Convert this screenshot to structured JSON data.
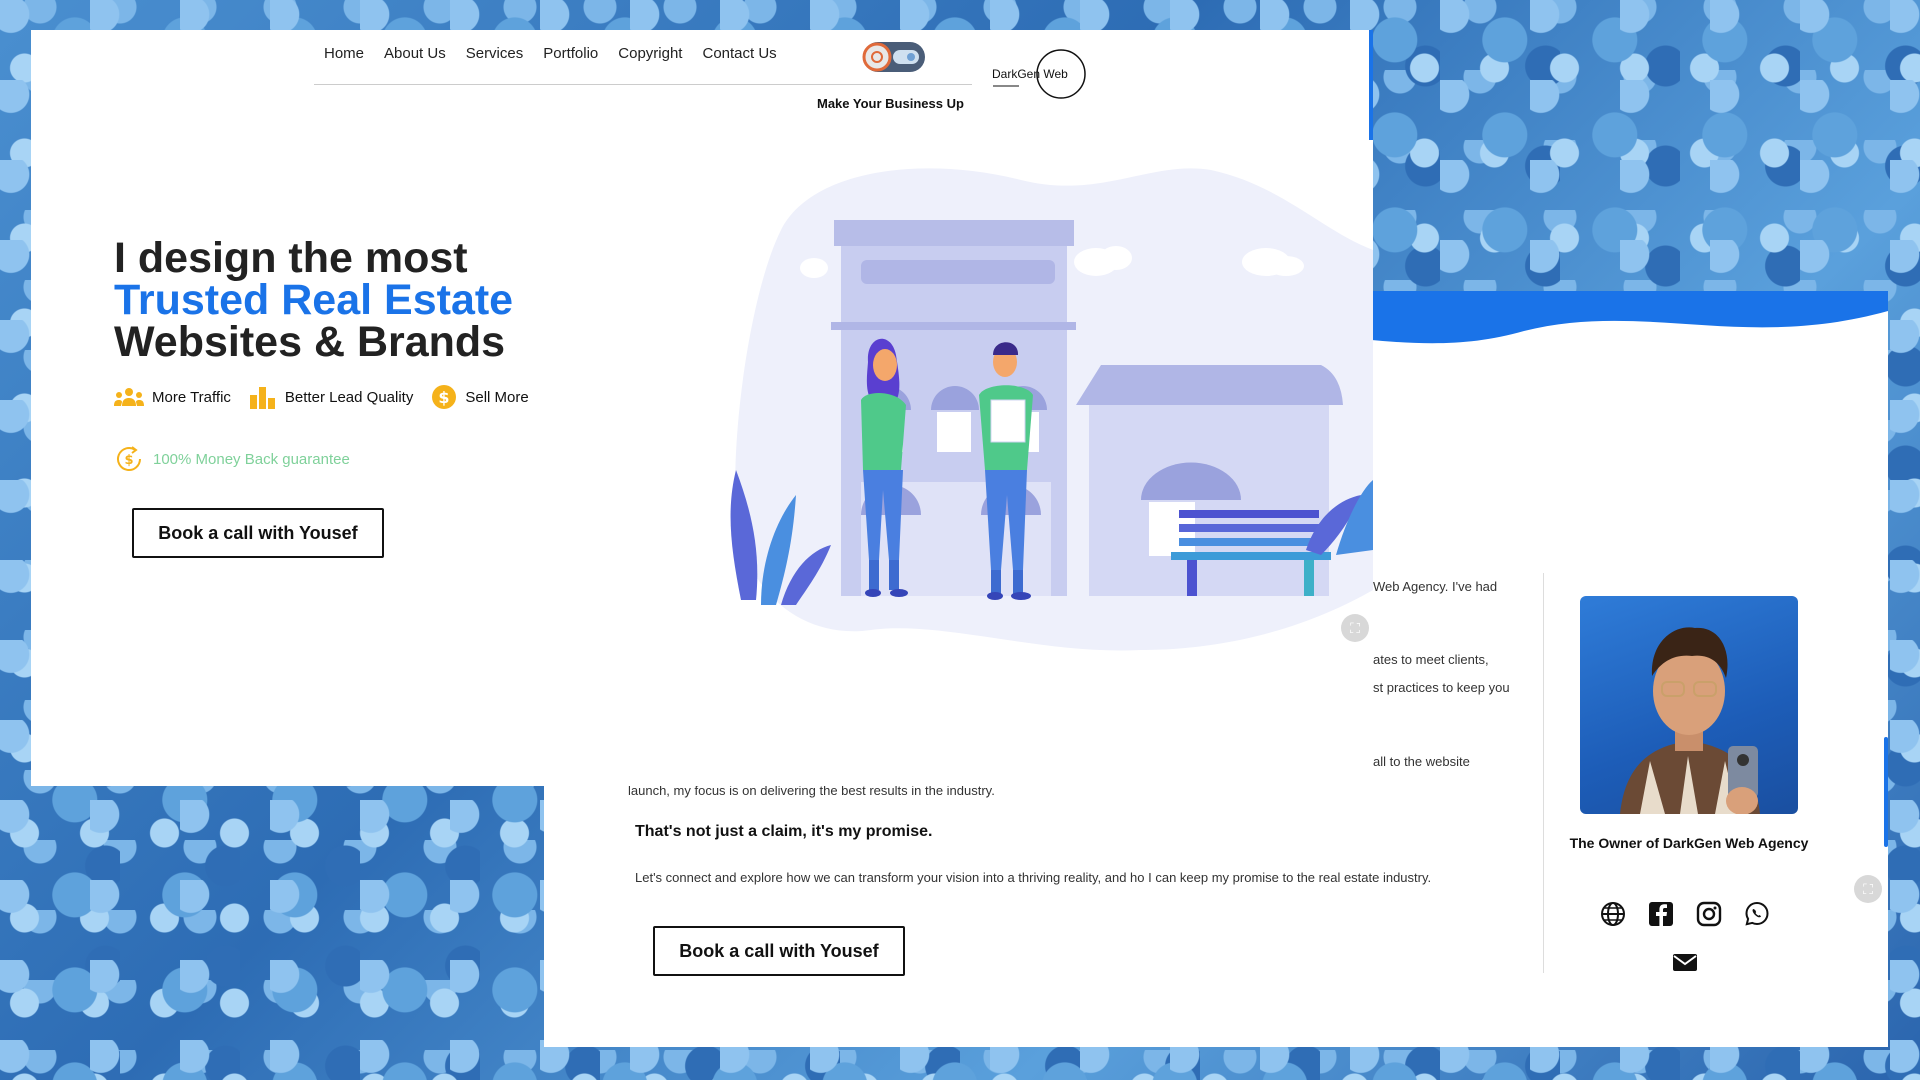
{
  "nav": {
    "items": [
      {
        "label": "Home"
      },
      {
        "label": "About Us"
      },
      {
        "label": "Services"
      },
      {
        "label": "Portfolio"
      },
      {
        "label": "Copyright"
      },
      {
        "label": "Contact Us"
      }
    ],
    "tagline": "Make Your Business Up",
    "brand_logo_text": "DarkGen Web"
  },
  "hero": {
    "title_line1": "I design the most",
    "title_line2": "Trusted Real Estate",
    "title_line3": "Websites & Brands",
    "accent_color": "#1a73e8",
    "features": [
      {
        "icon": "people-icon",
        "label": "More Traffic"
      },
      {
        "icon": "bar-chart-icon",
        "label": "Better Lead Quality"
      },
      {
        "icon": "dollar-coin-icon",
        "label": "Sell More"
      }
    ],
    "guarantee": "100% Money Back guarantee",
    "cta": "Book a call with Yousef"
  },
  "about": {
    "bio_fragments": [
      "Web Agency. I've had",
      "ates to meet clients,",
      "st practices to keep you",
      "all to the website",
      "launch, my focus is on delivering the best results in the industry."
    ],
    "promise": "That's not just a claim, it's my promise.",
    "connect": "Let's connect and explore how we can transform your vision into a thriving reality, and ho I can keep my promise to the real estate industry.",
    "cta": "Book a call with Yousef",
    "owner_title": "The Owner of DarkGen Web Agency",
    "social_icons": [
      "globe-icon",
      "facebook-icon",
      "instagram-icon",
      "whatsapp-icon",
      "email-icon"
    ]
  }
}
